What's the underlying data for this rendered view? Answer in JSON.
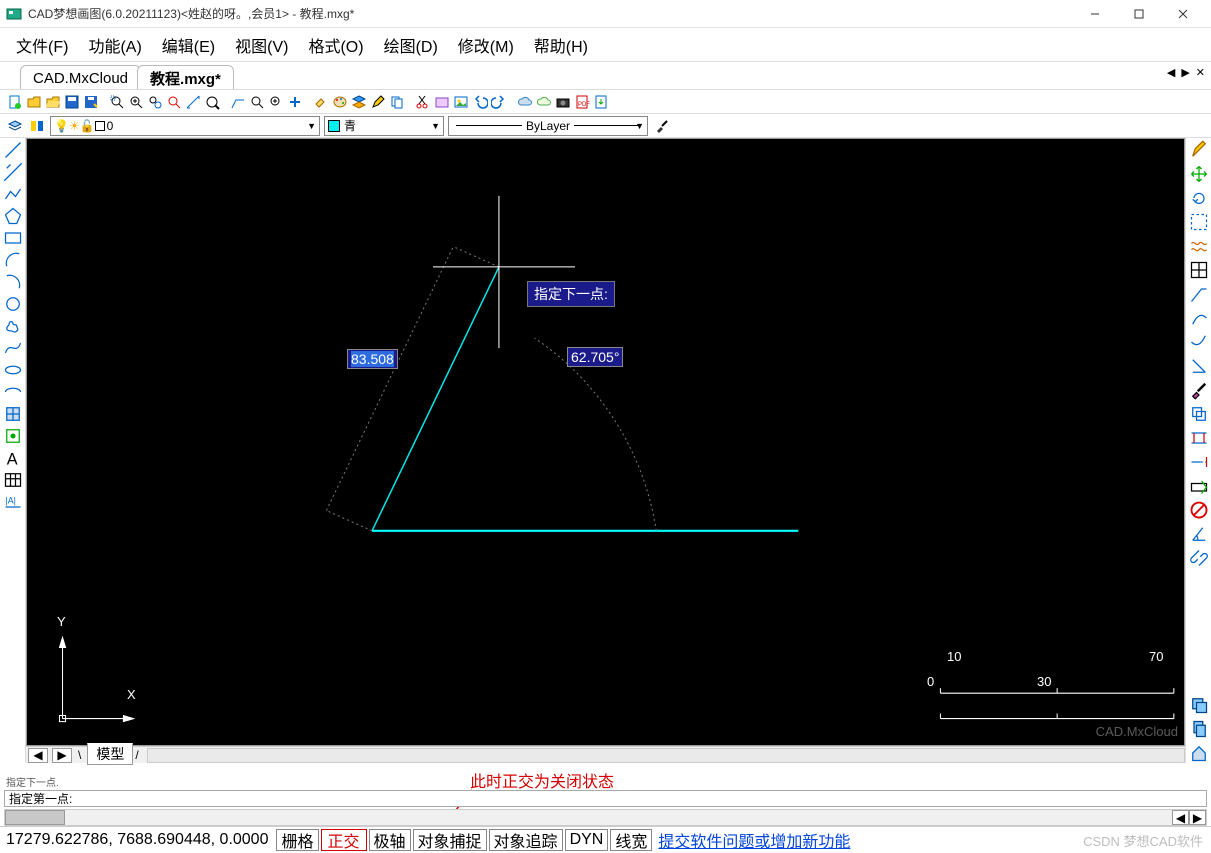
{
  "title": "CAD梦想画图(6.0.20211123)<姓赵的呀。,会员1> - 教程.mxg*",
  "menus": [
    "文件(F)",
    "功能(A)",
    "编辑(E)",
    "视图(V)",
    "格式(O)",
    "绘图(D)",
    "修改(M)",
    "帮助(H)"
  ],
  "tabs": {
    "inactive": "CAD.MxCloud",
    "active": "教程.mxg*"
  },
  "layer": {
    "name": "0"
  },
  "color": {
    "name": "青"
  },
  "linetype": "ByLayer",
  "prompt_tip": "指定下一点:",
  "length_value": "83.508",
  "angle_value": "62.705°",
  "axis": {
    "x": "X",
    "y": "Y"
  },
  "scale": {
    "t1": "10",
    "t2": "70",
    "b1": "0",
    "b2": "30"
  },
  "model_tab": "模型",
  "cmd_prompt": "指定第一点:",
  "cmd_hint": "指定下一点.",
  "annotation": "此时正交为关闭状态",
  "coords": "17279.622786,   7688.690448,   0.0000",
  "status_buttons": [
    "栅格",
    "正交",
    "极轴",
    "对象捕捉",
    "对象追踪",
    "DYN",
    "线宽"
  ],
  "status_link": "提交软件问题或增加新功能",
  "watermark": "CSDN 梦想CAD软件",
  "icons": {
    "logo": "logo",
    "min": "min",
    "max": "max",
    "close": "close",
    "new": "new-file",
    "open": "open",
    "openf": "open-folder",
    "save": "save",
    "saveas": "saveas",
    "zoomwin": "zoom-win",
    "zoomin": "zoom-in",
    "zoomall": "zoom-all",
    "zoomext": "zoom-ext",
    "zoomprev": "zoom-prev",
    "pan": "pan",
    "measure": "measure",
    "angle": "angle-measure",
    "find": "find",
    "zoom": "zoom",
    "add": "add",
    "paint": "paint",
    "palette": "palette",
    "layers": "layers",
    "edit": "edit",
    "copy": "copy",
    "paste": "paste",
    "cut": "cut",
    "img": "image",
    "undo": "undo",
    "redo": "redo",
    "cloud1": "cloud",
    "cloud2": "cloud-alt",
    "veh": "vehicle",
    "pdf": "pdf",
    "export": "export",
    "layermgr": "layer-mgr",
    "layerstate": "layer-state",
    "brush": "brush-icon",
    "line": "line",
    "xline": "xline",
    "pline": "polyline",
    "polygon": "polygon",
    "rect": "rectangle",
    "arc": "arc",
    "circle": "circle",
    "revcloud": "revision-cloud",
    "spline": "spline",
    "ellipse": "ellipse",
    "ellipsearc": "ellipse-arc",
    "block": "insert-block",
    "makeblock": "make-block",
    "point": "point",
    "hatch": "hatch",
    "region": "region",
    "text": "text",
    "table": "table",
    "dim": "dimension",
    "pen": "pen",
    "move": "move",
    "rotate": "rotate",
    "scale": "scale",
    "rectsel": "rect-select",
    "wave": "wavy",
    "leader": "leader",
    "curve": "curve",
    "grip": "grip",
    "esc": "escape",
    "mirror": "mirror",
    "offset": "offset",
    "stretch": "stretch",
    "trim": "trim",
    "extend": "extend",
    "break": "break",
    "noentry": "no-entry",
    "angtool": "angle-tool",
    "link": "link",
    "copies": "copy-stack",
    "pages": "pages",
    "home": "home"
  }
}
